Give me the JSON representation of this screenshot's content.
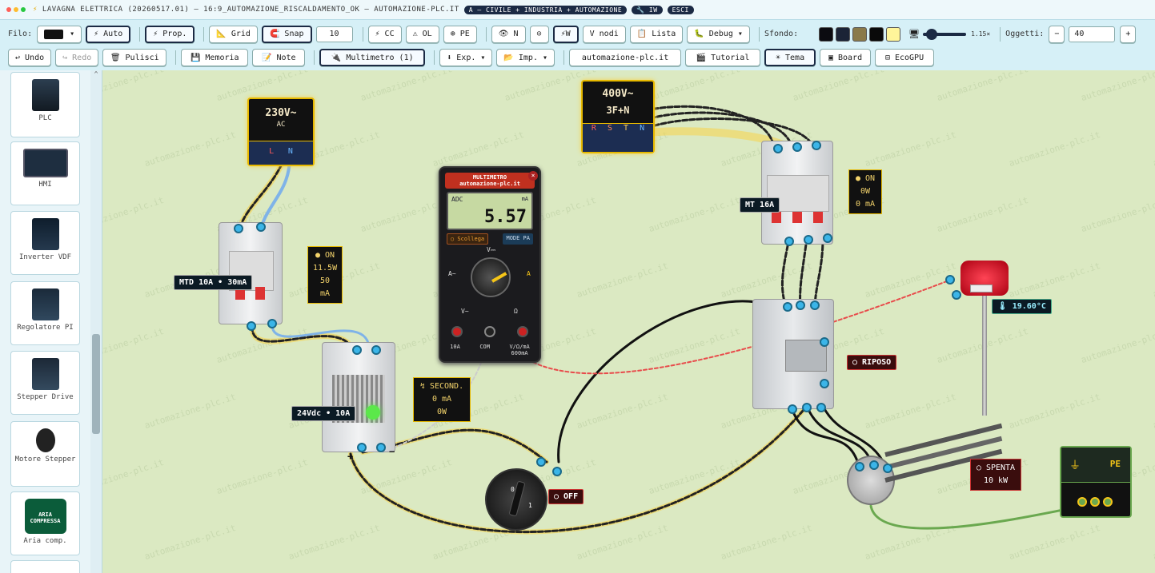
{
  "titlebar": {
    "title": "LAVAGNA ELETTRICA (20260517.01) — 16:9_AUTOMAZIONE_RISCALDAMENTO_OK — AUTOMAZIONE-PLC.IT",
    "badge1": "A — CIVILE + INDUSTRIA + AUTOMAZIONE",
    "badge2": "🔧 IW",
    "badge3": "ESCI"
  },
  "toolbar1": {
    "filo_label": "Filo:",
    "auto": "⚡ Auto",
    "prop": "⚡ Prop.",
    "grid": "📐 Grid",
    "snap": "🧲 Snap",
    "snap_value": "10",
    "cc": "⚡ CC",
    "ol": "⚠ OL",
    "pe": "⊕ PE",
    "n": "👁 N",
    "zero": "⊙",
    "w": "⚡W",
    "vnodi": "V nodi",
    "lista": "📋 Lista",
    "debug": "🐛 Debug ▾",
    "sfondo_label": "Sfondo:",
    "zoom_value": "1.15×",
    "oggetti_label": "Oggetti:",
    "minus": "−",
    "oggetti_value": "40",
    "plus": "+",
    "swatches": [
      "#0b0b10",
      "#1b2336",
      "#8a7a4a",
      "#0a0a0a",
      "#fff59a"
    ]
  },
  "toolbar2": {
    "undo": "↩ Undo",
    "redo": "↪ Redo",
    "pulisci": "🗑 Pulisci",
    "memoria": "💾 Memoria",
    "note": "📝 Note",
    "multimetro": "🔌 Multimetro (1)",
    "exp": "⬇ Exp. ▾",
    "imp": "📂 Imp. ▾",
    "site": "automazione-plc.it",
    "tutorial": "🎬 Tutorial",
    "tema": "☀ Tema",
    "board": "▣ Board",
    "ecogpu": "⊟ EcoGPU"
  },
  "sidebar": {
    "items": [
      "PLC",
      "HMI",
      "Inverter VDF",
      "Regolatore PI",
      "Stepper Drive",
      "Motore Stepper",
      "Aria comp."
    ],
    "aria_icon_text": "ARIA COMPRESSA"
  },
  "canvas": {
    "watermark": "automazione-plc.it",
    "supply230": {
      "voltage": "230V~",
      "type": "AC",
      "l": "L",
      "n": "N"
    },
    "supply400": {
      "voltage": "400V~",
      "type": "3F+N",
      "r": "R",
      "s": "S",
      "t": "T",
      "n": "N"
    },
    "mtd_tag": "MTD 10A • 30mA",
    "mtd_info": [
      "● ON",
      "11.5W",
      "50 mA"
    ],
    "mt_tag": "MT 16A",
    "mt_info": [
      "● ON",
      "0W",
      "0 mA"
    ],
    "psu_tag": "24Vdc • 10A",
    "psu_plus": "+",
    "psu_minus": "−",
    "second_info": [
      "↯ SECOND.",
      "0 mA",
      "0W"
    ],
    "multimeter": {
      "title": "MULTIMETRO",
      "subtitle": "automazione-plc.it",
      "mode": "ADC",
      "unit": "mA",
      "value": "5.57",
      "scollega": "○ Scollega",
      "modepa": "MODE PA",
      "dial_v_dc": "V⎓",
      "dial_a_ac": "A~",
      "dial_a": "A",
      "dial_v_ac": "V~",
      "dial_ohm": "Ω",
      "jack_10a": "10A",
      "jack_com": "COM",
      "jack_v": "V/Ω/mA",
      "jack_v2": "600mA",
      "close": "×"
    },
    "relay_tag": "○ RIPOSO",
    "switch_tag": "○ OFF",
    "switch_0": "0",
    "switch_1": "1",
    "temp_tag": "🌡 19.60°C",
    "heater_tag": [
      "○ SPENTA",
      "10 kW"
    ],
    "pe_label": "PE"
  }
}
